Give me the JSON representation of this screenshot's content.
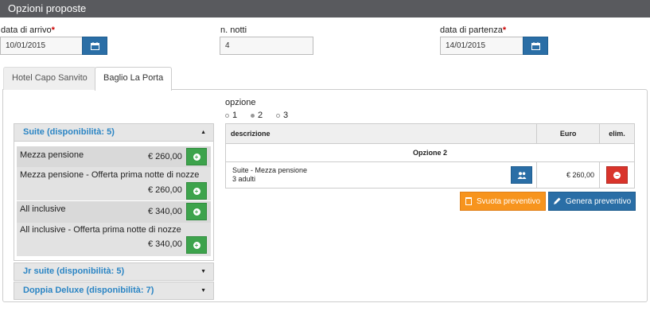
{
  "header": {
    "title": "Opzioni proposte"
  },
  "form": {
    "arrival_label": "data di arrivo",
    "arrival_value": "10/01/2015",
    "nights_label": "n. notti",
    "nights_value": "4",
    "departure_label": "data di partenza",
    "departure_value": "14/01/2015",
    "required_mark": "*"
  },
  "tabs": [
    {
      "label": "Hotel Capo Sanvito"
    },
    {
      "label": "Baglio La Porta"
    }
  ],
  "rooms": {
    "suite": {
      "title": "Suite (disponibilità: 5)",
      "caret": "▲",
      "options": [
        {
          "name": "Mezza pensione",
          "price": "€ 260,00"
        },
        {
          "name": "Mezza pensione - Offerta prima notte di nozze",
          "price": "€ 260,00"
        },
        {
          "name": "All inclusive",
          "price": "€ 340,00"
        },
        {
          "name": "All inclusive - Offerta prima notte di nozze",
          "price": "€ 340,00"
        }
      ]
    },
    "jr_suite": {
      "title": "Jr suite (disponibilità: 5)",
      "caret": "▼"
    },
    "doppia": {
      "title": "Doppia Deluxe (disponibilità: 7)",
      "caret": "▼"
    }
  },
  "options": {
    "label": "opzione",
    "items": [
      "1",
      "2",
      "3"
    ],
    "selected": "2"
  },
  "quote_table": {
    "headers": [
      "descrizione",
      "Euro",
      "elim."
    ],
    "group_title": "Opzione 2",
    "rows": [
      {
        "description": "Suite - Mezza pensione",
        "guests": "3 adulti",
        "price": "€ 260,00"
      }
    ]
  },
  "actions": {
    "clear_label": "Svuota preventivo",
    "generate_label": "Genera preventivo"
  },
  "colors": {
    "accent_blue": "#2a6ea6",
    "link_blue": "#2b85c4",
    "green": "#3da34c",
    "red": "#d9342b",
    "orange": "#f7941d",
    "header_gray": "#595a5e"
  }
}
